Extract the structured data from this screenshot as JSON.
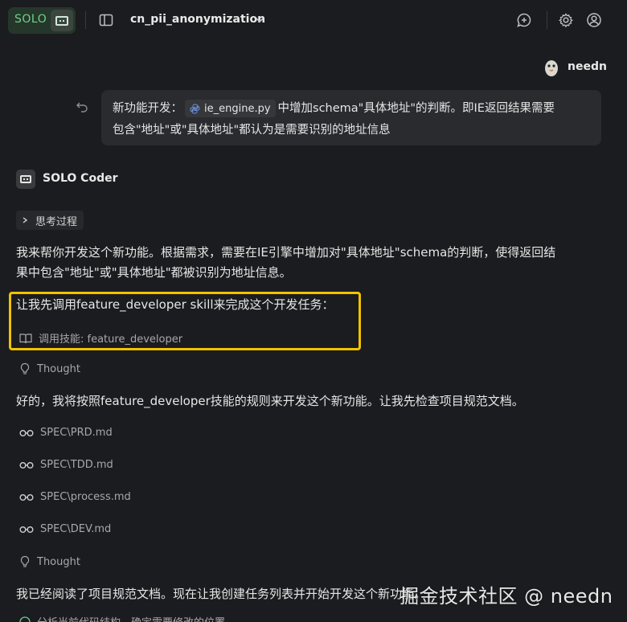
{
  "header": {
    "brand": "SOLO",
    "project": "cn_pii_anonymization",
    "icons": [
      "sidebar-toggle-icon",
      "chevron-down-icon",
      "new-chat-icon",
      "gear-icon",
      "account-icon"
    ]
  },
  "user": {
    "name": "needn",
    "message_line1_prefix": "新功能开发：",
    "file_chip": "ie_engine.py",
    "message_line1_suffix": "中增加schema\"具体地址\"的判断。即IE返回结果需要",
    "message_line2": "包含\"地址\"或\"具体地址\"都认为是需要识别的地址信息"
  },
  "assistant": {
    "name": "SOLO Coder",
    "thinking_label": "思考过程",
    "para1_line1": "我来帮你开发这个新功能。根据需求，需要在IE引擎中增加对\"具体地址\"schema的判断，使得返回结",
    "para1_line2": "果中包含\"地址\"或\"具体地址\"都被识别为地址信息。",
    "para2": "让我先调用feature_developer skill来完成这个开发任务：",
    "skill_call": "调用技能: feature_developer",
    "thought1": "Thought",
    "para3": "好的，我将按照feature_developer技能的规则来开发这个新功能。让我先检查项目规范文档。",
    "files_read": [
      "SPEC\\PRD.md",
      "SPEC\\TDD.md",
      "SPEC\\process.md",
      "SPEC\\DEV.md"
    ],
    "thought2": "Thought",
    "para4": "我已经阅读了项目规范文档。现在让我创建任务列表并开始开发这个新功能。",
    "partial_task": "分析当前代码结构，确定需要修改的位置"
  },
  "watermark": "掘金技术社区 @ needn",
  "colors": {
    "background": "#1b1c1f",
    "bubble": "#2a2b2f",
    "brand_green": "#6fd089",
    "highlight": "#f2c200",
    "muted_text": "#a8a8ab"
  }
}
